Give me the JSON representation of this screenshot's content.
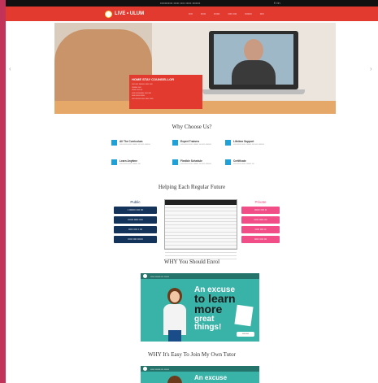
{
  "topbar": {
    "info": "••••••••••• ••••• •••• ••••• •••••••",
    "icons": "f  t  in"
  },
  "nav": {
    "logo_text": "LIVE • ULUM",
    "menu": [
      "••••",
      "•••••",
      "••••••",
      "•••• ••••",
      "•••••••",
      "••••"
    ]
  },
  "hero": {
    "heading": "HOME STAY COUNSELLOR",
    "lines": [
      "•••• •••• •••••••• ••••• ••••",
      "•••••••• ••••",
      "•••••• •••• •••",
      "••••• ••••••••••• •••• ••••",
      "••••• ••••• ••••••",
      "•••• •••••••• •••• ••••• •••••"
    ]
  },
  "why": {
    "title": "Why Choose Us?",
    "features": [
      {
        "title": "All The Curriculum",
        "desc": "•••• •••••• ••••• ••••••• ••• •••• ••••••••"
      },
      {
        "title": "Expert Trainers",
        "desc": "•••• •••••• ••••• ••••••• ••• •••• ••••••••"
      },
      {
        "title": "Lifetime Support",
        "desc": "•••• •••••• ••••• ••••••• ••• •••• ••••••••"
      },
      {
        "title": "Learn Anytime",
        "desc": "•••• •••••• ••••• ••••••• •••"
      },
      {
        "title": "Flexible Schedule",
        "desc": "•••• •••••• ••••• ••••••• ••• •••• ••••••••"
      },
      {
        "title": "Certificate",
        "desc": "•••• •••••• ••••• ••••••• •••"
      }
    ]
  },
  "compare": {
    "title": "Helping Each Regular Future",
    "left_head": "Public",
    "right_head": "Private",
    "left_items": [
      "• ••••••• •••• •••",
      "•••••• ••••• ••••",
      "••••• •••• • •••",
      "••••• •••• ••••••"
    ],
    "right_items": [
      "•••••• •••• ••",
      "••••• ••••• •••",
      "••••• •••• ••",
      "••••• •••• •••"
    ]
  },
  "video1": {
    "section": "WHY You Should Enrol",
    "title": "••••• ••••••• ••• ••••••",
    "line1": "An excuse",
    "line2": "to learn",
    "line3": "more",
    "line4": "great",
    "line5": "things!",
    "sign": "•••• ••••"
  },
  "video2": {
    "section": "WHY It's Easy To Join My Own Tutor",
    "title": "••••• ••••••• ••• ••••••",
    "line1": "An excuse"
  }
}
